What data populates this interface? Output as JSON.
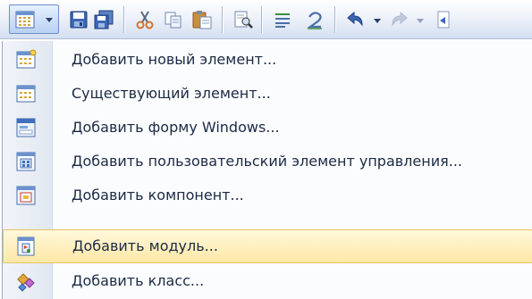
{
  "toolbar": {
    "buttons": [
      {
        "name": "add-item-split",
        "icon": "grid-icon"
      },
      {
        "name": "save",
        "icon": "floppy-disk-icon"
      },
      {
        "name": "save-all",
        "icon": "save-all-icon"
      },
      {
        "name": "cut",
        "icon": "scissors-icon"
      },
      {
        "name": "copy",
        "icon": "copy-icon"
      },
      {
        "name": "paste",
        "icon": "clipboard-icon"
      },
      {
        "name": "find",
        "icon": "find-in-files-icon"
      },
      {
        "name": "comment",
        "icon": "comment-lines-icon"
      },
      {
        "name": "uncomment",
        "icon": "uncomment-lines-icon"
      },
      {
        "name": "undo",
        "icon": "undo-icon"
      },
      {
        "name": "redo",
        "icon": "redo-icon"
      }
    ]
  },
  "menu": {
    "items": [
      {
        "label": "Добавить новый элемент...",
        "icon": "new-item-icon",
        "highlighted": false
      },
      {
        "label": "Существующий элемент...",
        "icon": "existing-item-icon",
        "highlighted": false
      },
      {
        "label": "Добавить форму Windows...",
        "icon": "windows-form-icon",
        "highlighted": false
      },
      {
        "label": "Добавить пользовательский элемент управления...",
        "icon": "user-control-icon",
        "highlighted": false
      },
      {
        "label": "Добавить компонент...",
        "icon": "component-icon",
        "highlighted": false
      },
      {
        "label": "Добавить модуль...",
        "icon": "module-icon",
        "highlighted": true
      },
      {
        "label": "Добавить класс...",
        "icon": "class-icon",
        "highlighted": false
      }
    ]
  },
  "colors": {
    "highlight_fill": "#ffe8a6",
    "highlight_border": "#e5c365",
    "menu_text": "#1c2a44"
  }
}
